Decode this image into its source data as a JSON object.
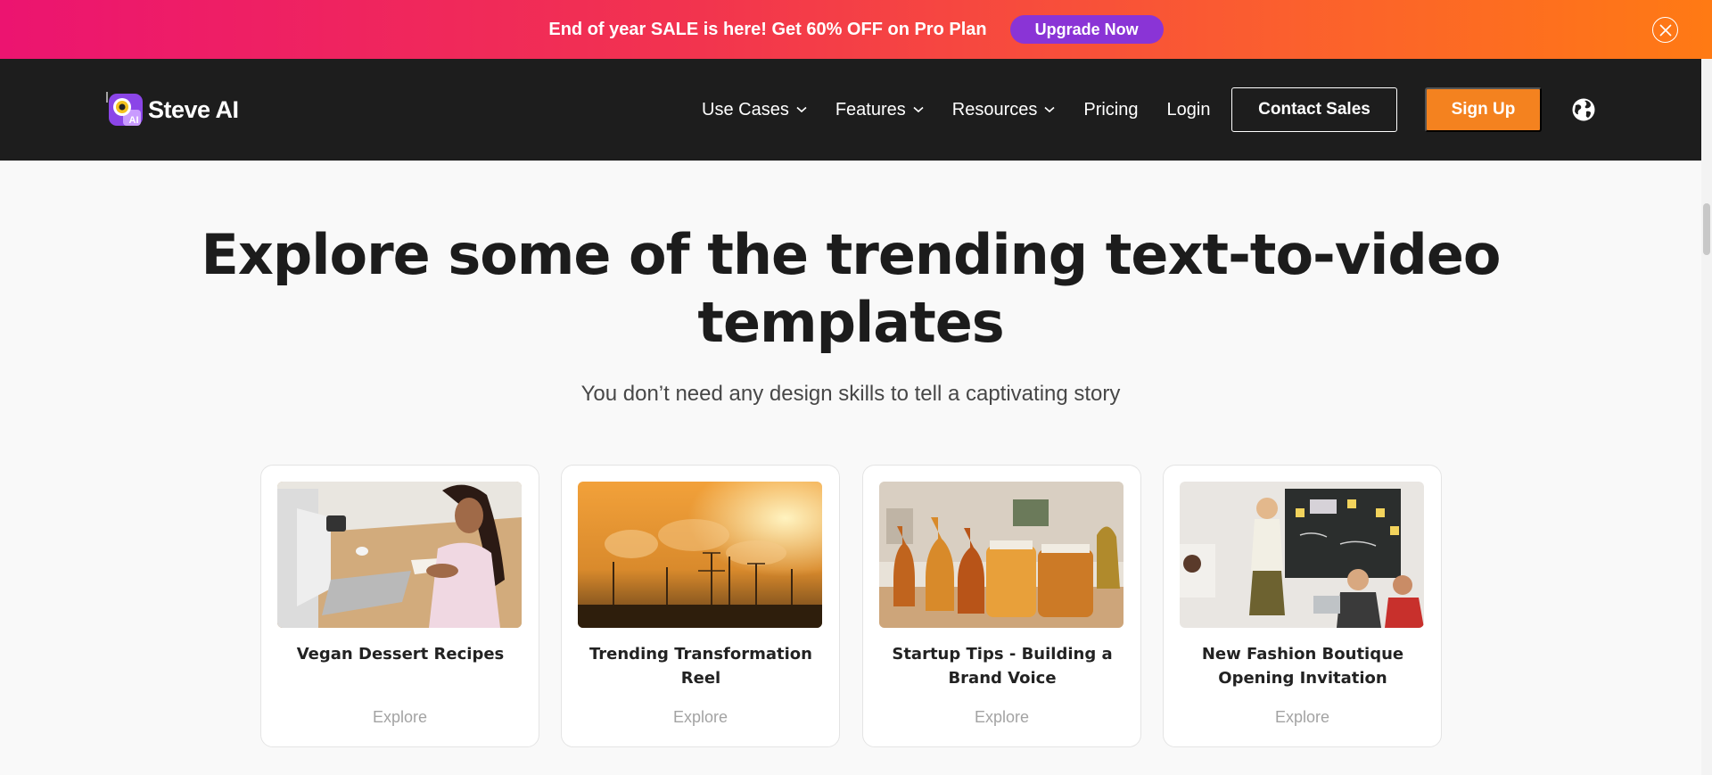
{
  "promo": {
    "text": "End of year SALE is here! Get 60% OFF on Pro Plan",
    "cta_label": "Upgrade Now",
    "colors": [
      "#ec1470",
      "#ff7a14"
    ]
  },
  "nav": {
    "brand": "Steve AI",
    "items": [
      {
        "label": "Use Cases",
        "dropdown": true
      },
      {
        "label": "Features",
        "dropdown": true
      },
      {
        "label": "Resources",
        "dropdown": true
      },
      {
        "label": "Pricing",
        "dropdown": false
      },
      {
        "label": "Login",
        "dropdown": false
      }
    ],
    "contact_label": "Contact Sales",
    "signup_label": "Sign Up",
    "accent_color": "#f4821f"
  },
  "hero": {
    "title_line1": "Explore some of the trending text-to-video",
    "title_line2": "templates",
    "subtitle": "You don’t need any design skills to tell a captivating story"
  },
  "templates": [
    {
      "title": "Vegan Dessert Recipes",
      "cta": "Explore"
    },
    {
      "title": "Trending Transformation Reel",
      "cta": "Explore"
    },
    {
      "title": "Startup Tips - Building a Brand Voice",
      "cta": "Explore"
    },
    {
      "title": "New Fashion Boutique Opening Invitation",
      "cta": "Explore"
    }
  ]
}
